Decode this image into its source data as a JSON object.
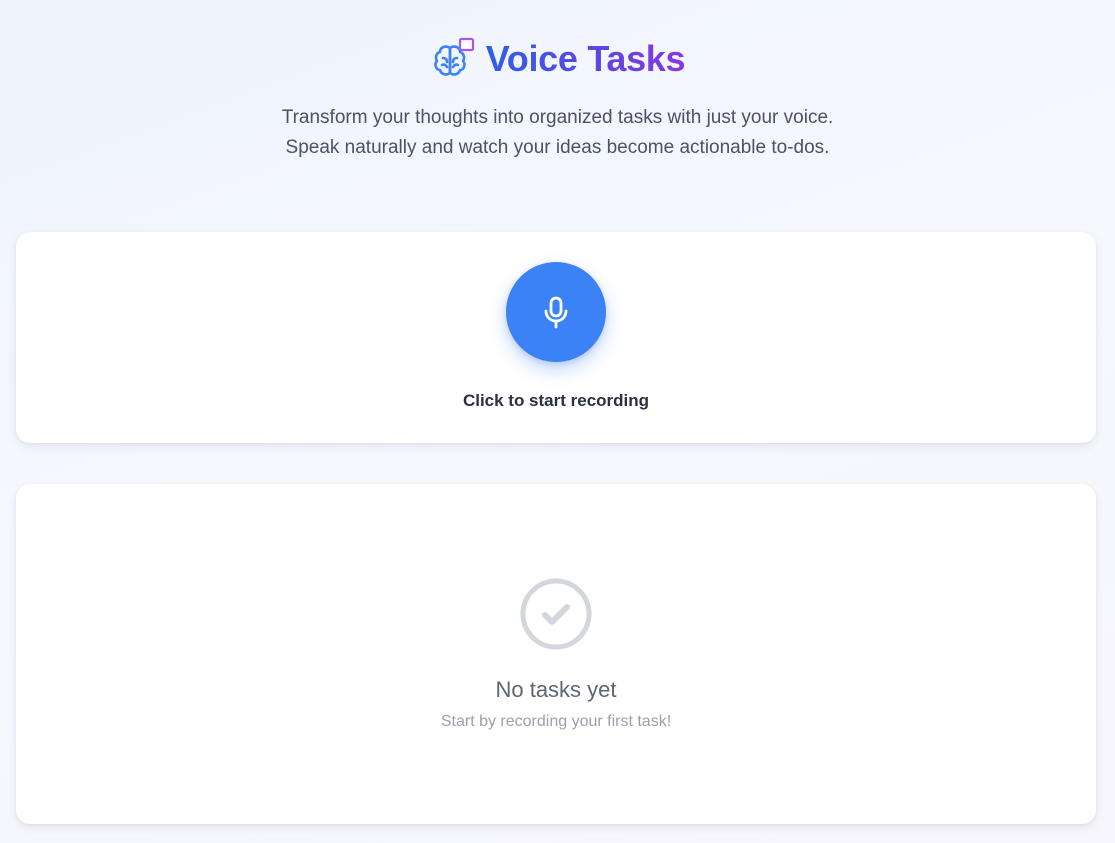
{
  "header": {
    "title": "Voice Tasks",
    "subtitle": "Transform your thoughts into organized tasks with just your voice. Speak naturally and watch your ideas become actionable to-dos.",
    "icon": "brain-icon"
  },
  "recorder": {
    "button_icon": "microphone-icon",
    "status_label": "Click to start recording",
    "accent_color": "#3b82f6"
  },
  "tasks": {
    "empty_icon": "check-circle-icon",
    "empty_title": "No tasks yet",
    "empty_subtitle": "Start by recording your first task!"
  },
  "colors": {
    "title_gradient_start": "#2f5fe6",
    "title_gradient_end": "#8b35e3"
  }
}
